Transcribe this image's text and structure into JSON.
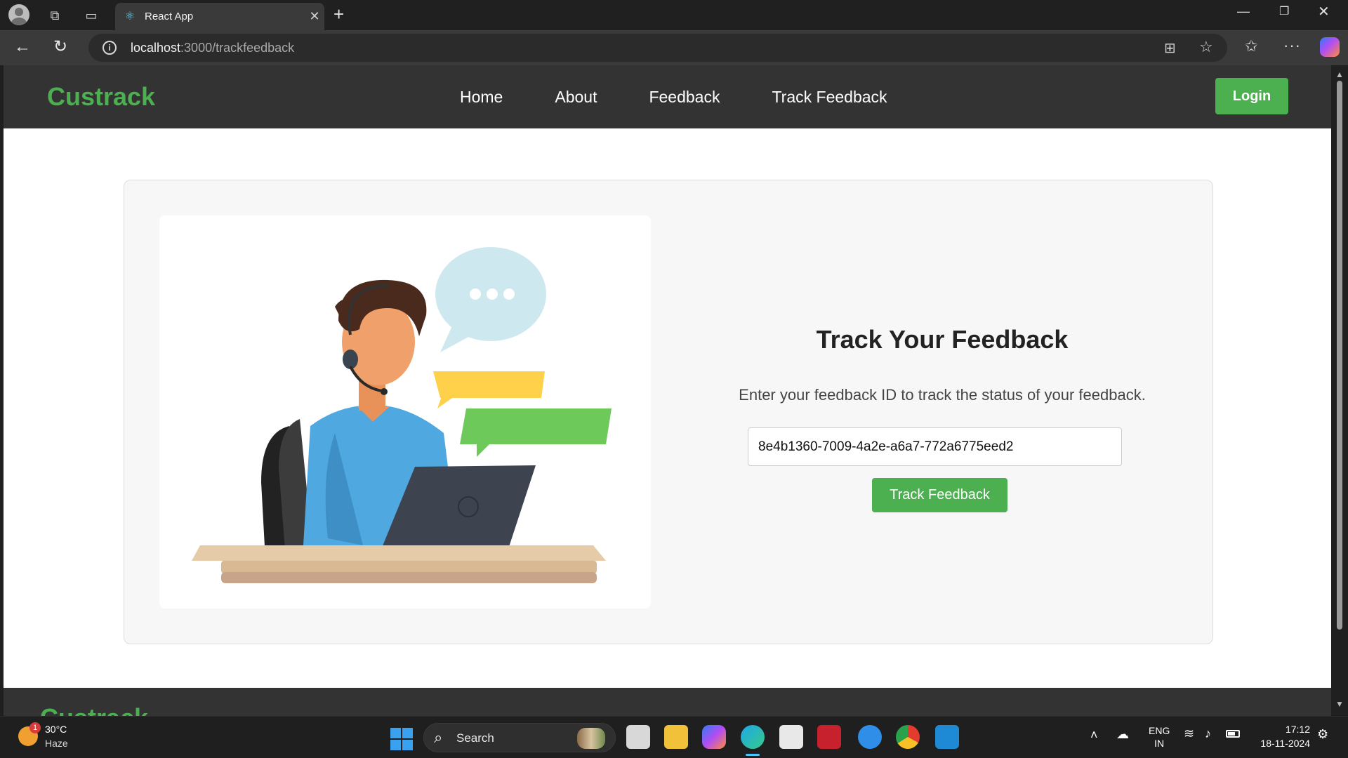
{
  "browser": {
    "tab_title": "React App",
    "url_host": "localhost",
    "url_path": ":3000/trackfeedback"
  },
  "navbar": {
    "brand": "Custrack",
    "links": [
      "Home",
      "About",
      "Feedback",
      "Track Feedback"
    ],
    "login_label": "Login"
  },
  "track": {
    "title": "Track Your Feedback",
    "subtitle": "Enter your feedback ID to track the status of your feedback.",
    "input_value": "8e4b1360-7009-4a2e-a6a7-772a6775eed2",
    "button_label": "Track Feedback"
  },
  "footer": {
    "brand": "Custrack"
  },
  "taskbar": {
    "weather_temp": "30°C",
    "weather_condition": "Haze",
    "weather_badge": "1",
    "search_label": "Search",
    "lang_line1": "ENG",
    "lang_line2": "IN",
    "time": "17:12",
    "date": "18-11-2024"
  },
  "colors": {
    "brand_green": "#4caf50",
    "navbar_bg": "#333333"
  }
}
